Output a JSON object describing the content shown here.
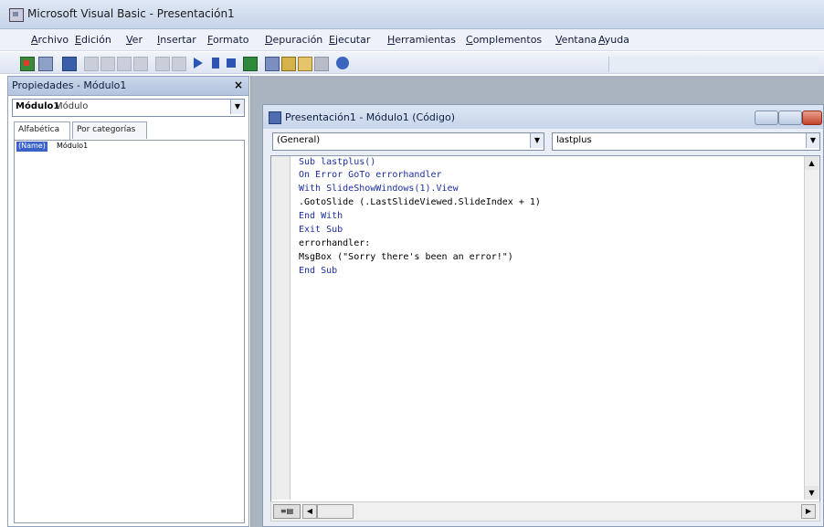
{
  "window": {
    "title": "Microsoft Visual Basic - Presentación1"
  },
  "menu": [
    "Archivo",
    "Edición",
    "Ver",
    "Insertar",
    "Formato",
    "Depuración",
    "Ejecutar",
    "Herramientas",
    "Complementos",
    "Ventana",
    "Ayuda"
  ],
  "toolbar": {
    "icons": [
      "excel-icon",
      "form-icon",
      "save-icon",
      "cut-icon",
      "copy-icon",
      "paste-icon",
      "find-icon",
      "undo-icon",
      "redo-icon",
      "run-icon",
      "pause-icon",
      "stop-icon",
      "design-mode-icon",
      "project-explorer-icon",
      "properties-icon",
      "object-browser-icon",
      "toolbox-icon",
      "help-icon"
    ],
    "status": ""
  },
  "properties": {
    "title": "Propiedades - Módulo1",
    "object_name": "Módulo1",
    "object_type": "Módulo",
    "tabs": [
      "Alfabética",
      "Por categorías"
    ],
    "rows": [
      {
        "name": "(Name)",
        "value": "Módulo1"
      }
    ]
  },
  "code_window": {
    "title": "Presentación1 - Módulo1 (Código)",
    "object_combo": "(General)",
    "proc_combo": "lastplus",
    "lines": [
      {
        "text": "Sub lastplus()",
        "kind": "kw"
      },
      {
        "text": "On Error GoTo errorhandler",
        "kind": "kw"
      },
      {
        "text": "With SlideShowWindows(1).View",
        "kind": "kw"
      },
      {
        "text": ".GotoSlide (.LastSlideViewed.SlideIndex + 1)",
        "kind": "plain"
      },
      {
        "text": "End With",
        "kind": "kw"
      },
      {
        "text": "Exit Sub",
        "kind": "kw"
      },
      {
        "text": "errorhandler:",
        "kind": "plain"
      },
      {
        "text": "MsgBox (\"Sorry there's been an error!\")",
        "kind": "plain"
      },
      {
        "text": "End Sub",
        "kind": "kw"
      }
    ]
  },
  "colors": {
    "keyword": "#1c2fa0",
    "selection": "#3a62c9"
  }
}
